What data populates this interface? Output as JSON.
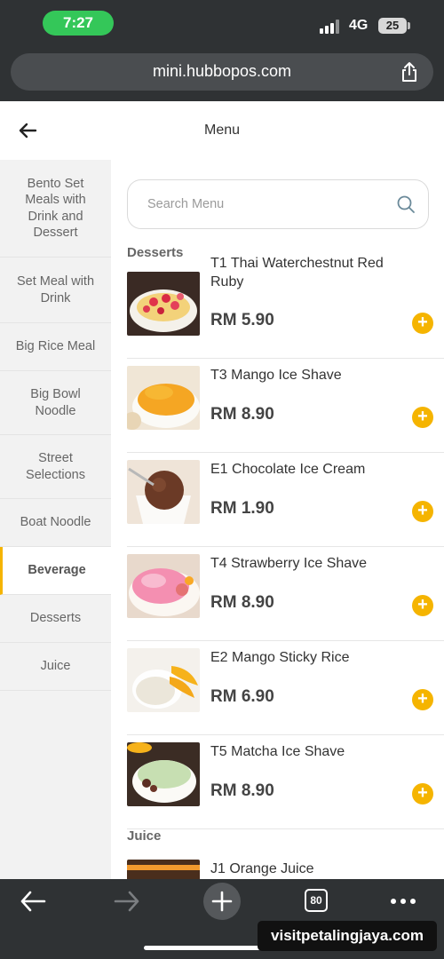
{
  "status": {
    "time": "7:27",
    "network": "4G",
    "battery": "25"
  },
  "browser": {
    "url": "mini.hubbopos.com",
    "tab_count": "80"
  },
  "header": {
    "title": "Menu"
  },
  "sidebar": {
    "items": [
      {
        "label": "Bento Set Meals with Drink and Dessert",
        "active": false
      },
      {
        "label": "Set Meal with Drink",
        "active": false
      },
      {
        "label": "Big Rice Meal",
        "active": false
      },
      {
        "label": "Big Bowl Noodle",
        "active": false
      },
      {
        "label": "Street Selections",
        "active": false
      },
      {
        "label": "Boat Noodle",
        "active": false
      },
      {
        "label": "Beverage",
        "active": true
      },
      {
        "label": "Desserts",
        "active": false
      },
      {
        "label": "Juice",
        "active": false
      }
    ]
  },
  "search": {
    "placeholder": "Search Menu"
  },
  "sections": [
    {
      "title": "Desserts",
      "items": [
        {
          "name": "T1 Thai Waterchestnut Red Ruby",
          "price": "RM 5.90"
        },
        {
          "name": "T3 Mango Ice Shave",
          "price": "RM 8.90"
        },
        {
          "name": "E1 Chocolate Ice Cream",
          "price": "RM 1.90"
        },
        {
          "name": "T4 Strawberry Ice Shave",
          "price": "RM 8.90"
        },
        {
          "name": "E2 Mango Sticky Rice",
          "price": "RM 6.90"
        },
        {
          "name": "T5 Matcha Ice Shave",
          "price": "RM 8.90"
        }
      ]
    },
    {
      "title": "Juice",
      "items": [
        {
          "name": "J1 Orange Juice",
          "price": ""
        }
      ]
    }
  ],
  "add_symbol": "+",
  "watermark": "visitpetalingjaya.com",
  "colors": {
    "accent": "#f5b400",
    "status_green": "#34c759",
    "chrome_dark": "#2f3234"
  }
}
